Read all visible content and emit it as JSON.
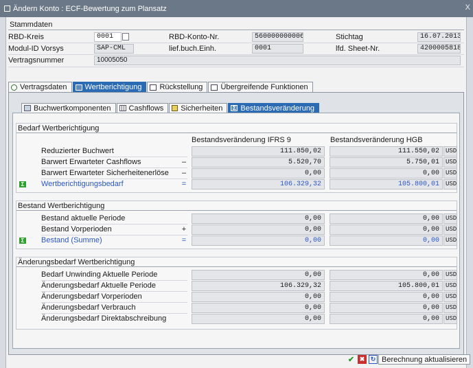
{
  "window": {
    "title": "Ändern Konto : ECF-Bewertung zum Plansatz",
    "close_glyph": "X"
  },
  "stamm": {
    "title": "Stammdaten",
    "rbd_kreis_label": "RBD-Kreis",
    "rbd_kreis_value": "0001",
    "rbd_konto_label": "RBD-Konto-Nr.",
    "rbd_konto_value": "5600000000065",
    "stichtag_label": "Stichtag",
    "stichtag_value": "16.07.2013",
    "modul_label": "Modul-ID Vorsys",
    "modul_value": "SAP-CML",
    "liefbuch_label": "lief.buch.Einh.",
    "liefbuch_value": "0001",
    "sheet_label": "lfd. Sheet-Nr.",
    "sheet_value": "4200005818",
    "vertrag_label": "Vertragsnummer",
    "vertrag_value": "10005050"
  },
  "tabs_main": [
    {
      "label": "Vertragsdaten",
      "icon": "magnifier-icon"
    },
    {
      "label": "Wertberichtigung",
      "icon": "table-icon"
    },
    {
      "label": "Rückstellung",
      "icon": "document-icon"
    },
    {
      "label": "Übergreifende Funktionen",
      "icon": "document-icon"
    }
  ],
  "tabs_sub": [
    {
      "label": "Buchwertkomponenten",
      "icon": "components-icon"
    },
    {
      "label": "Cashflows",
      "icon": "table-icon"
    },
    {
      "label": "Sicherheiten",
      "icon": "shield-icon"
    },
    {
      "label": "Bestandsveränderung",
      "icon": "sigma-icon"
    }
  ],
  "columns": {
    "ifrs": "Bestandsveränderung IFRS 9",
    "hgb": "Bestandsveränderung HGB",
    "currency": "USD"
  },
  "group1": {
    "title": "Bedarf Wertberichtigung",
    "rows": [
      {
        "label": "Reduzierter Buchwert",
        "op": "",
        "ifrs": "111.850,02",
        "hgb": "111.550,02"
      },
      {
        "label": "Barwert Erwarteter Cashflows",
        "op": "–",
        "ifrs": "5.520,70",
        "hgb": "5.750,01"
      },
      {
        "label": "Barwert Erwarteter Sicherheitenerlöse",
        "op": "–",
        "ifrs": "0,00",
        "hgb": "0,00"
      },
      {
        "label": "Wertberichtigungsbedarf",
        "op": "=",
        "ifrs": "106.329,32",
        "hgb": "105.800,01"
      }
    ]
  },
  "group2": {
    "title": "Bestand Wertberichtigung",
    "rows": [
      {
        "label": "Bestand aktuelle Periode",
        "op": "",
        "ifrs": "0,00",
        "hgb": "0,00"
      },
      {
        "label": "Bestand Vorperioden",
        "op": "+",
        "ifrs": "0,00",
        "hgb": "0,00"
      },
      {
        "label": "Bestand (Summe)",
        "op": "=",
        "ifrs": "0,00",
        "hgb": "0,00"
      }
    ]
  },
  "group3": {
    "title": "Änderungsbedarf Wertberichtigung",
    "rows": [
      {
        "label": "Bedarf Unwinding Aktuelle Periode",
        "ifrs": "0,00",
        "hgb": "0,00"
      },
      {
        "label": "Änderungsbedarf Aktuelle Periode",
        "ifrs": "106.329,32",
        "hgb": "105.800,01"
      },
      {
        "label": "Änderungsbedarf Vorperioden",
        "ifrs": "0,00",
        "hgb": "0,00"
      },
      {
        "label": "Änderungsbedarf Verbrauch",
        "ifrs": "0,00",
        "hgb": "0,00"
      },
      {
        "label": "Änderungsbedarf Direktabschreibung",
        "ifrs": "0,00",
        "hgb": "0,00"
      }
    ]
  },
  "sigma_glyph": "Σ",
  "footer": {
    "calc_label": "Berechnung aktualisieren",
    "ok_glyph": "✔",
    "cancel_glyph": "✖",
    "refresh_glyph": "↻"
  }
}
